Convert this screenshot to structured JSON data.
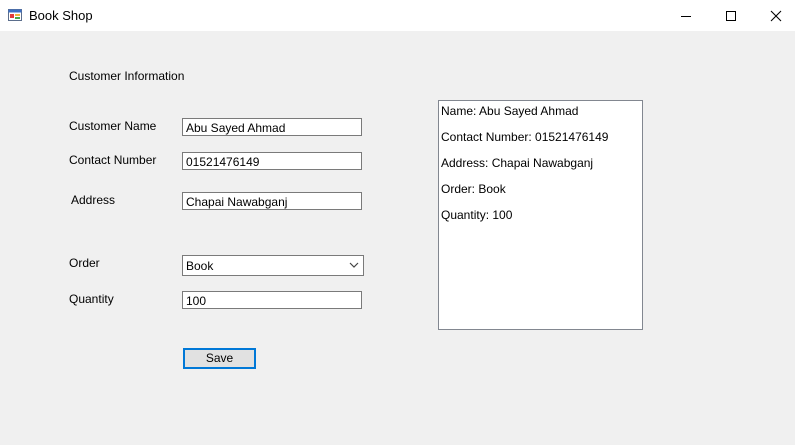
{
  "window": {
    "title": "Book Shop"
  },
  "form": {
    "section_title": "Customer Information",
    "customer_name_label": "Customer Name",
    "customer_name_value": "Abu Sayed Ahmad",
    "contact_number_label": "Contact Number",
    "contact_number_value": "01521476149",
    "address_label": "Address",
    "address_value": "Chapai Nawabganj",
    "order_label": "Order",
    "order_value": "Book",
    "quantity_label": "Quantity",
    "quantity_value": "100",
    "save_label": "Save"
  },
  "output": {
    "lines": [
      "Name: Abu Sayed Ahmad",
      "Contact Number: 01521476149",
      "Address: Chapai Nawabganj",
      "Order: Book",
      "Quantity: 100"
    ]
  },
  "icons": {
    "app": "forms-app-icon",
    "minimize": "minimize-icon",
    "maximize": "maximize-icon",
    "close": "close-icon",
    "dropdown": "chevron-down-icon"
  },
  "colors": {
    "focus_border": "#0078d7",
    "window_bg": "#f0f0f0",
    "titlebar_bg": "#ffffff"
  }
}
